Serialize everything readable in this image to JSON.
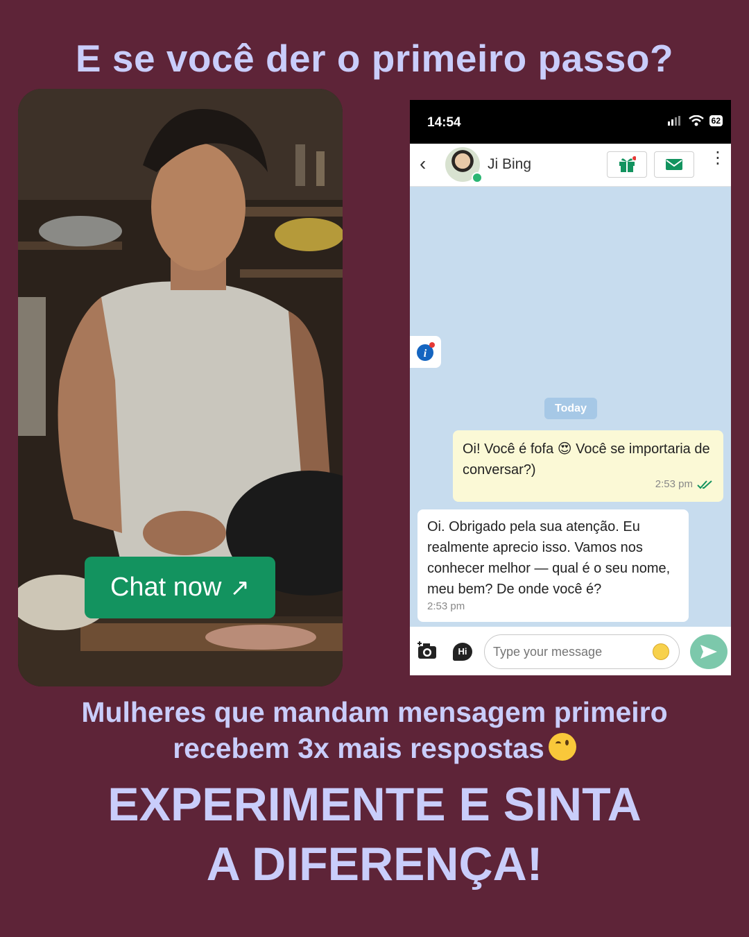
{
  "headline": "E se você der o primeiro passo?",
  "photo": {
    "cta_label": "Chat now",
    "cta_arrow": "↗"
  },
  "phone": {
    "status_time": "14:54",
    "battery": "62",
    "contact_name": "Ji Bing",
    "today_label": "Today",
    "messages": [
      {
        "direction": "outgoing",
        "text_before_emoji": "Oi! Você é fofa ",
        "emoji": "😍",
        "text_after_emoji": " Você se importaria de conversar?)",
        "time": "2:53 pm",
        "status": "read"
      },
      {
        "direction": "incoming",
        "text": "Oi. Obrigado pela sua atenção. Eu realmente aprecio isso. Vamos nos conhecer melhor — qual é o seu nome, meu bem? De onde você é?",
        "time": "2:53 pm"
      }
    ],
    "input_placeholder": "Type your message",
    "hi_label": "Hi"
  },
  "subtext_line1": "Mulheres que mandam mensagem primeiro",
  "subtext_line2": "recebem 3x mais respostas",
  "cta_line1": "EXPERIMENTE E SINTA",
  "cta_line2": "A DIFERENÇA!",
  "colors": {
    "background": "#5e2438",
    "headline": "#c9cdfb",
    "chat_button": "#13935f",
    "chat_bg": "#c7dcee",
    "outgoing_bubble": "#fbf9d6",
    "send_button": "#7cc8ab"
  },
  "icons": [
    "back-icon",
    "gift-icon",
    "mail-icon",
    "more-icon",
    "info-icon",
    "camera-icon",
    "emoji-icon",
    "send-icon",
    "read-check-icon",
    "wifi-icon",
    "signal-icon"
  ]
}
